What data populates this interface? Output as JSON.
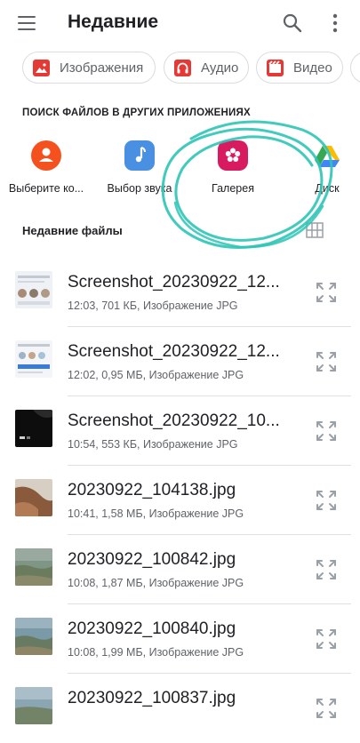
{
  "header": {
    "title": "Недавние"
  },
  "chips": [
    {
      "label": "Изображения",
      "icon": "image-icon",
      "color": "#e53935"
    },
    {
      "label": "Аудио",
      "icon": "headphones-icon",
      "color": "#e53935"
    },
    {
      "label": "Видео",
      "icon": "film-icon",
      "color": "#e53935"
    }
  ],
  "apps_section": {
    "heading": "ПОИСК ФАЙЛОВ В ДРУГИХ ПРИЛОЖЕНИЯХ",
    "apps": [
      {
        "label": "Выберите ко...",
        "icon": "contact-icon",
        "color": "#f4511e"
      },
      {
        "label": "Выбор звука",
        "icon": "music-note-icon",
        "color": "#4a90e2"
      },
      {
        "label": "Галерея",
        "icon": "gallery-flower-icon",
        "color": "#d81b60"
      },
      {
        "label": "Диск",
        "icon": "google-drive-icon",
        "color": "#34a853"
      }
    ]
  },
  "recent": {
    "heading": "Недавние файлы",
    "files": [
      {
        "name": "Screenshot_20230922_12...",
        "meta": "12:03, 701 КБ, Изображение JPG"
      },
      {
        "name": "Screenshot_20230922_12...",
        "meta": "12:02, 0,95 МБ, Изображение JPG"
      },
      {
        "name": "Screenshot_20230922_10...",
        "meta": "10:54, 553 КБ, Изображение JPG"
      },
      {
        "name": "20230922_104138.jpg",
        "meta": "10:41, 1,58 МБ, Изображение JPG"
      },
      {
        "name": "20230922_100842.jpg",
        "meta": "10:08, 1,87 МБ, Изображение JPG"
      },
      {
        "name": "20230922_100840.jpg",
        "meta": "10:08, 1,99 МБ, Изображение JPG"
      },
      {
        "name": "20230922_100837.jpg",
        "meta": ""
      }
    ]
  },
  "colors": {
    "annotation": "#2ec4b6",
    "accent_red": "#e53935"
  }
}
